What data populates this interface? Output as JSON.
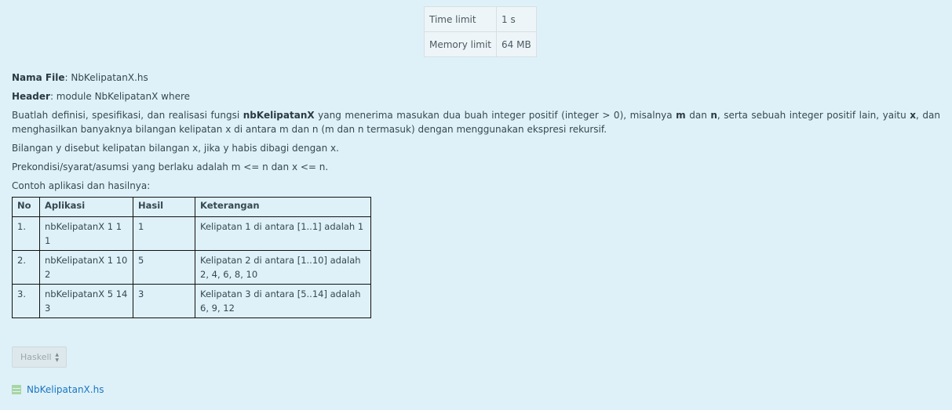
{
  "limits": {
    "time_label": "Time limit",
    "time_value": "1 s",
    "memory_label": "Memory limit",
    "memory_value": "64 MB"
  },
  "problem": {
    "file_label": "Nama File",
    "file_value": ": NbKelipatanX.hs",
    "header_label": "Header",
    "header_value": ": module NbKelipatanX where",
    "desc_1": "Buatlah definisi, spesifikasi, dan realisasi fungsi ",
    "desc_fn": "nbKelipatanX",
    "desc_2": " yang menerima masukan dua buah integer positif (integer > 0), misalnya ",
    "desc_m": "m",
    "desc_3": " dan ",
    "desc_n": "n",
    "desc_4": ", serta sebuah integer positif lain, yaitu ",
    "desc_x": "x",
    "desc_5": ", dan menghasilkan banyaknya bilangan kelipatan x di antara m dan n (m dan n termasuk) dengan menggunakan ekspresi rekursif.",
    "definition": "Bilangan y disebut kelipatan bilangan x, jika y habis dibagi dengan x.",
    "precondition": "Prekondisi/syarat/asumsi yang berlaku adalah m <= n dan x <= n.",
    "example_intro": "Contoh aplikasi dan hasilnya:"
  },
  "examples": {
    "headers": [
      "No",
      "Aplikasi",
      "Hasil",
      "Keterangan"
    ],
    "rows": [
      [
        "1.",
        "nbKelipatanX 1 1 1",
        "1",
        "Kelipatan 1 di antara [1..1] adalah 1"
      ],
      [
        "2.",
        "nbKelipatanX 1 10 2",
        "5",
        "Kelipatan 2 di antara [1..10] adalah 2, 4, 6, 8, 10"
      ],
      [
        "3.",
        "nbKelipatanX 5 14 3",
        "3",
        "Kelipatan 3 di antara [5..14] adalah 6, 9, 12"
      ]
    ]
  },
  "language_select": {
    "value": "Haskell",
    "icon": "up-down-arrows-icon"
  },
  "file": {
    "name": "NbKelipatanX.hs",
    "icon": "file-icon"
  }
}
